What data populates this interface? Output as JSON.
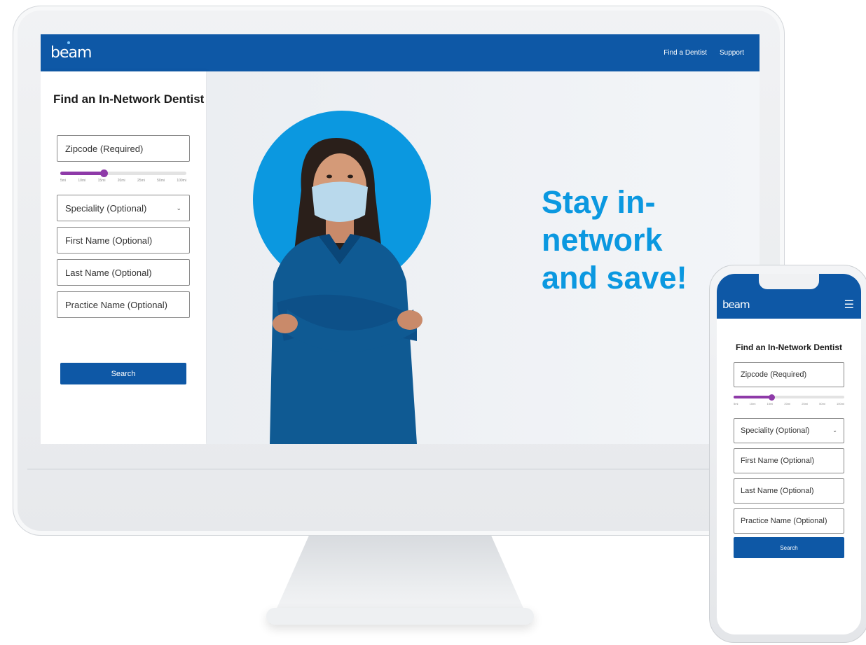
{
  "brand": {
    "logo": "beam",
    "color": "#0e58a6",
    "accent": "#8e3aa8",
    "headline_color": "#0b98e0"
  },
  "desktop": {
    "nav": {
      "find_dentist": "Find a Dentist",
      "support": "Support"
    },
    "form": {
      "title": "Find an In-Network Dentist",
      "zipcode": "Zipcode (Required)",
      "speciality": "Speciality (Optional)",
      "first_name": "First Name (Optional)",
      "last_name": "Last Name (Optional)",
      "practice_name": "Practice Name (Optional)",
      "search": "Search",
      "radius_options": [
        "5mi",
        "10mi",
        "15mi",
        "20mi",
        "25mi",
        "50mi",
        "100mi"
      ],
      "radius_selected": "15mi"
    },
    "hero": {
      "headline": "Stay in-network and save!"
    }
  },
  "mobile": {
    "logo": "beam",
    "menu_icon": "hamburger-icon",
    "form": {
      "title": "Find an In-Network Dentist",
      "zipcode": "Zipcode (Required)",
      "speciality": "Speciality (Optional)",
      "first_name": "First Name (Optional)",
      "last_name": "Last Name (Optional)",
      "practice_name": "Practice Name (Optional)",
      "search": "Search",
      "radius_options": [
        "5mi",
        "10mi",
        "15mi",
        "20mi",
        "25mi",
        "50mi",
        "100mi"
      ],
      "radius_selected": "15mi"
    }
  }
}
